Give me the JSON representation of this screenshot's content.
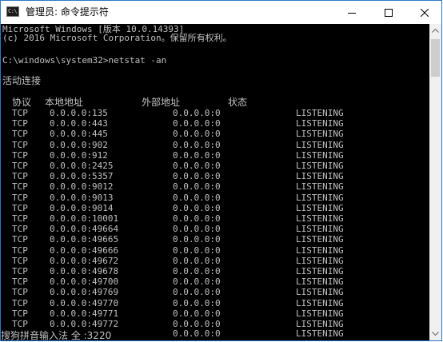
{
  "window": {
    "title": "管理员: 命令提示符",
    "icon": "cmd-icon",
    "icon_text": "C:\\"
  },
  "controls": {
    "minimize": "minimize-icon",
    "maximize": "maximize-icon",
    "close": "close-icon"
  },
  "console": {
    "banner_line1": "Microsoft Windows [版本 10.0.14393]",
    "banner_line2": "(c) 2016 Microsoft Corporation。保留所有权利。",
    "prompt": "C:\\windows\\system32>netstat -an",
    "section_title": "活动连接",
    "headers": {
      "proto": "协议",
      "local": "本地地址",
      "foreign": "外部地址",
      "state": "状态"
    },
    "rows": [
      {
        "proto": "TCP",
        "local": "0.0.0.0:135",
        "foreign": "0.0.0.0:0",
        "state": "LISTENING"
      },
      {
        "proto": "TCP",
        "local": "0.0.0.0:443",
        "foreign": "0.0.0.0:0",
        "state": "LISTENING"
      },
      {
        "proto": "TCP",
        "local": "0.0.0.0:445",
        "foreign": "0.0.0.0:0",
        "state": "LISTENING"
      },
      {
        "proto": "TCP",
        "local": "0.0.0.0:902",
        "foreign": "0.0.0.0:0",
        "state": "LISTENING"
      },
      {
        "proto": "TCP",
        "local": "0.0.0.0:912",
        "foreign": "0.0.0.0:0",
        "state": "LISTENING"
      },
      {
        "proto": "TCP",
        "local": "0.0.0.0:2425",
        "foreign": "0.0.0.0:0",
        "state": "LISTENING"
      },
      {
        "proto": "TCP",
        "local": "0.0.0.0:5357",
        "foreign": "0.0.0.0:0",
        "state": "LISTENING"
      },
      {
        "proto": "TCP",
        "local": "0.0.0.0:9012",
        "foreign": "0.0.0.0:0",
        "state": "LISTENING"
      },
      {
        "proto": "TCP",
        "local": "0.0.0.0:9013",
        "foreign": "0.0.0.0:0",
        "state": "LISTENING"
      },
      {
        "proto": "TCP",
        "local": "0.0.0.0:9014",
        "foreign": "0.0.0.0:0",
        "state": "LISTENING"
      },
      {
        "proto": "TCP",
        "local": "0.0.0.0:10001",
        "foreign": "0.0.0.0:0",
        "state": "LISTENING"
      },
      {
        "proto": "TCP",
        "local": "0.0.0.0:49664",
        "foreign": "0.0.0.0:0",
        "state": "LISTENING"
      },
      {
        "proto": "TCP",
        "local": "0.0.0.0:49665",
        "foreign": "0.0.0.0:0",
        "state": "LISTENING"
      },
      {
        "proto": "TCP",
        "local": "0.0.0.0:49666",
        "foreign": "0.0.0.0:0",
        "state": "LISTENING"
      },
      {
        "proto": "TCP",
        "local": "0.0.0.0:49672",
        "foreign": "0.0.0.0:0",
        "state": "LISTENING"
      },
      {
        "proto": "TCP",
        "local": "0.0.0.0:49678",
        "foreign": "0.0.0.0:0",
        "state": "LISTENING"
      },
      {
        "proto": "TCP",
        "local": "0.0.0.0:49700",
        "foreign": "0.0.0.0:0",
        "state": "LISTENING"
      },
      {
        "proto": "TCP",
        "local": "0.0.0.0:49769",
        "foreign": "0.0.0.0:0",
        "state": "LISTENING"
      },
      {
        "proto": "TCP",
        "local": "0.0.0.0:49770",
        "foreign": "0.0.0.0:0",
        "state": "LISTENING"
      },
      {
        "proto": "TCP",
        "local": "0.0.0.0:49771",
        "foreign": "0.0.0.0:0",
        "state": "LISTENING"
      },
      {
        "proto": "TCP",
        "local": "0.0.0.0:49772",
        "foreign": "0.0.0.0:0",
        "state": "LISTENING"
      }
    ],
    "last_row_partial": {
      "foreign": "0.0.0.0:0",
      "state": "LISTENING"
    },
    "ime_status": "搜狗拼音输入法 全 :3220"
  },
  "scrollbar": {
    "thumb_start_fraction": 0.005,
    "thumb_fraction": 0.13
  },
  "colors": {
    "console_bg": "#000000",
    "console_fg": "#c0c0c0",
    "titlebar_bg": "#ffffff",
    "window_border": "#2b78c8",
    "scrollbar_track": "#f0f0f0",
    "scrollbar_thumb": "#cdcdcd"
  }
}
